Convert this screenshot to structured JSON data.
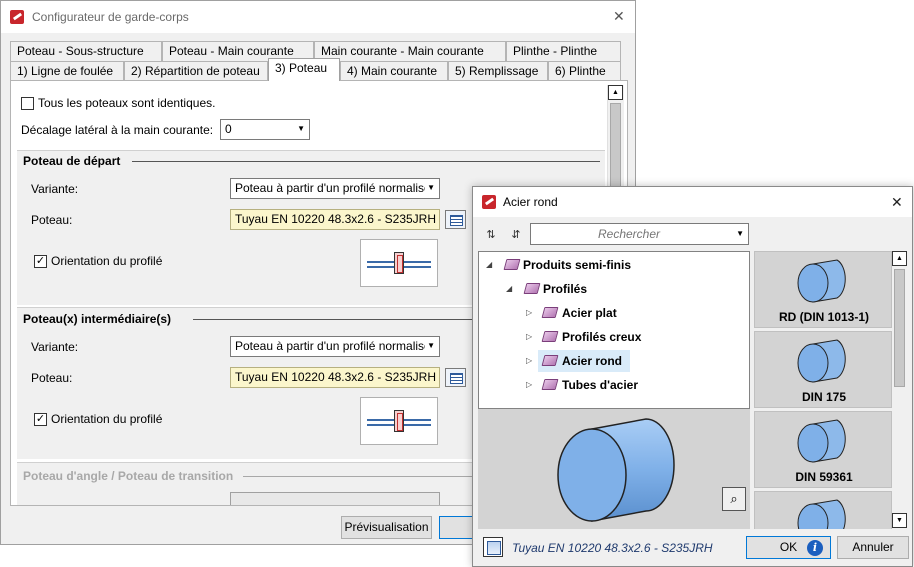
{
  "main": {
    "title": "Configurateur de garde-corps",
    "tabs_row1": [
      "Poteau - Sous-structure",
      "Poteau - Main courante",
      "Main courante - Main courante",
      "Plinthe - Plinthe"
    ],
    "tabs_row2": [
      "1) Ligne de foulée",
      "2) Répartition de poteau",
      "3) Poteau",
      "4) Main courante",
      "5) Remplissage",
      "6) Plinthe"
    ],
    "identical_label": "Tous les poteaux sont identiques.",
    "offset_label": "Décalage latéral à la main courante:",
    "offset_value": "0",
    "section_start": "Poteau de départ",
    "section_intermediate": "Poteau(x) intermédiaire(s)",
    "section_angle": "Poteau d'angle / Poteau de transition",
    "variant_label": "Variante:",
    "post_label": "Poteau:",
    "variant_value": "Poteau à partir d'un profilé normalisé",
    "post_value": "Tuyau EN 10220 48.3x2.6 - S235JRH",
    "orientation_label": "Orientation du profilé",
    "preview_button": "Prévisualisation"
  },
  "popup": {
    "title": "Acier rond",
    "search_placeholder": "Rechercher",
    "tree": [
      {
        "label": "Produits semi-finis",
        "level": 0,
        "arrow": "◢"
      },
      {
        "label": "Profilés",
        "level": 1,
        "arrow": "◢"
      },
      {
        "label": "Acier plat",
        "level": 2,
        "arrow": "▷"
      },
      {
        "label": "Profilés creux",
        "level": 2,
        "arrow": "▷"
      },
      {
        "label": "Acier rond",
        "level": 2,
        "arrow": "▷"
      },
      {
        "label": "Tubes d'acier",
        "level": 2,
        "arrow": "▷"
      }
    ],
    "catalog": [
      "RD (DIN 1013-1)",
      "DIN 175",
      "DIN 59361",
      ""
    ],
    "status": "Tuyau EN 10220 48.3x2.6 - S235JRH",
    "ok_label": "OK",
    "cancel_label": "Annuler",
    "info_glyph": "i"
  },
  "colors": {
    "field_yellow": "#fbf6cc",
    "selection_blue": "#d9ebf9",
    "accent": "#0078d7",
    "cylinder": "#7fb0e8"
  }
}
